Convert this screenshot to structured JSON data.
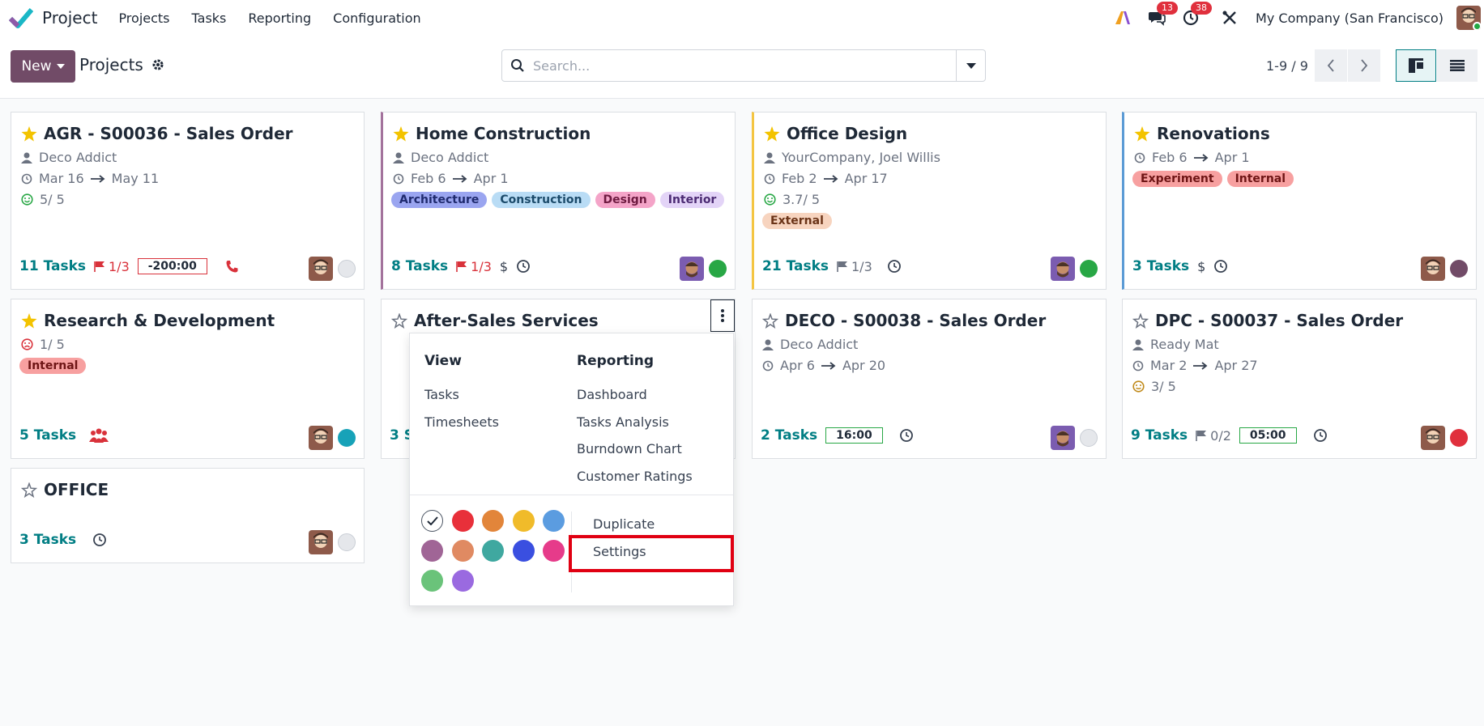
{
  "app": {
    "name": "Project"
  },
  "menu": [
    "Projects",
    "Tasks",
    "Reporting",
    "Configuration"
  ],
  "systray": {
    "messages_badge": "13",
    "activities_badge": "38",
    "company": "My Company (San Francisco)"
  },
  "control": {
    "new_label": "New",
    "breadcrumb": "Projects",
    "search_placeholder": "Search...",
    "pager": "1-9 / 9"
  },
  "colors": {
    "brand": "#714b67",
    "tasks_link": "#017e84",
    "danger": "#d9323b",
    "highlight": "#e00012"
  },
  "cards": [
    {
      "title": "AGR - S00036 - Sales Order",
      "starred": true,
      "partner": "Deco Addict",
      "date_start": "Mar 16",
      "date_end": "May 11",
      "rating": "5/ 5",
      "tasks": "11 Tasks",
      "milestone": "1/3",
      "time": "-200:00",
      "status": "grey",
      "accent": ""
    },
    {
      "title": "Home Construction",
      "starred": true,
      "partner": "Deco Addict",
      "date_start": "Feb 6",
      "date_end": "Apr 1",
      "tags": [
        "Architecture",
        "Construction",
        "Design",
        "Interior"
      ],
      "tasks": "8 Tasks",
      "milestone": "1/3",
      "status": "green",
      "accent": "#a3729c"
    },
    {
      "title": "Office Design",
      "starred": true,
      "partner": "YourCompany, Joel Willis",
      "date_start": "Feb 2",
      "date_end": "Apr 17",
      "rating": "3.7/ 5",
      "tags": [
        "External"
      ],
      "tasks": "21 Tasks",
      "milestone": "1/3",
      "status": "green",
      "accent": "#f4c542"
    },
    {
      "title": "Renovations",
      "starred": true,
      "date_start": "Feb 6",
      "date_end": "Apr 1",
      "tags": [
        "Experiment",
        "Internal"
      ],
      "tasks": "3 Tasks",
      "status": "purple",
      "accent": "#5b9bd5"
    },
    {
      "title": "Research & Development",
      "starred": true,
      "rating": "1/ 5",
      "tags": [
        "Internal"
      ],
      "tasks": "5 Tasks",
      "status": "teal"
    },
    {
      "title": "After-Sales Services",
      "starred": false,
      "tasks": "3 S"
    },
    {
      "title": "DECO - S00038 - Sales Order",
      "starred": false,
      "partner": "Deco Addict",
      "date_start": "Apr 6",
      "date_end": "Apr 20",
      "tasks": "2 Tasks",
      "time": "16:00",
      "status": "grey"
    },
    {
      "title": "DPC - S00037 - Sales Order",
      "starred": false,
      "partner": "Ready Mat",
      "date_start": "Mar 2",
      "date_end": "Apr 27",
      "rating": "3/ 5",
      "tasks": "9 Tasks",
      "milestone": "0/2",
      "time": "05:00",
      "status": "red"
    },
    {
      "title": "OFFICE",
      "starred": false,
      "tasks": "3 Tasks",
      "status": "grey"
    }
  ],
  "dropdown": {
    "view_heading": "View",
    "view_items": [
      "Tasks",
      "Timesheets"
    ],
    "reporting_heading": "Reporting",
    "reporting_items": [
      "Dashboard",
      "Tasks Analysis",
      "Burndown Chart",
      "Customer Ratings"
    ],
    "actions": [
      "Duplicate",
      "Settings"
    ],
    "swatches": [
      "#ffffff",
      "#e8303a",
      "#e2853a",
      "#f0bb2a",
      "#5b9ce0",
      "#a06596",
      "#e08a62",
      "#3fa8a0",
      "#3a4fe0",
      "#e63b8a",
      "#6ac37a",
      "#9a6ae0"
    ]
  }
}
